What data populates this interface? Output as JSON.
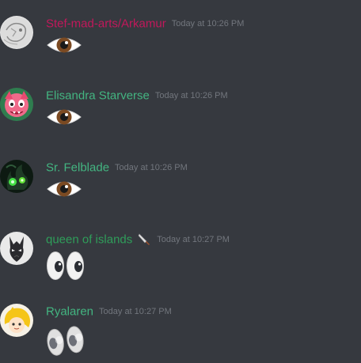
{
  "messages": [
    {
      "username": "Stef-mad-arts/Arkamur",
      "timestamp": "Today at 10:26 PM",
      "username_color": "#c2185b",
      "content": "eye-emoji",
      "avatar": "sketch-avatar"
    },
    {
      "username": "Elisandra Starverse",
      "timestamp": "Today at 10:26 PM",
      "username_color": "#43b581",
      "content": "eye-emoji",
      "avatar": "pink-character-avatar"
    },
    {
      "username": "Sr. Felblade",
      "timestamp": "Today at 10:26 PM",
      "username_color": "#43b581",
      "content": "eye-emoji",
      "avatar": "green-flame-avatar"
    },
    {
      "username": "queen of islands",
      "timestamp": "Today at 10:27 PM",
      "username_color": "#2f9e5a",
      "content": "eyes-emoji",
      "avatar": "dark-dragon-avatar",
      "username_icon": "knife-icon"
    },
    {
      "username": "Ryalaren",
      "timestamp": "Today at 10:27 PM",
      "username_color": "#43b581",
      "content": "eyes-emoji",
      "avatar": "yellow-character-avatar"
    }
  ],
  "colors": {
    "background": "#36393f",
    "timestamp": "#72767d"
  }
}
